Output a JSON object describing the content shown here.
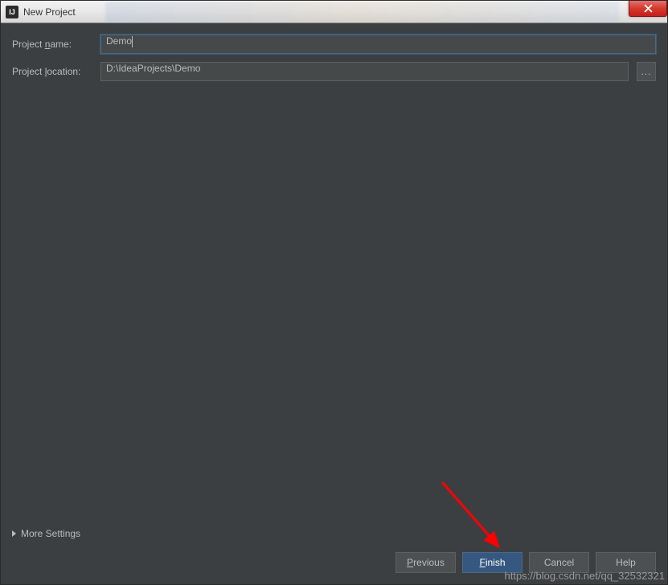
{
  "window": {
    "title": "New Project"
  },
  "form": {
    "project_name_label": "Project name:",
    "project_name_value": "Demo",
    "project_location_label": "Project location:",
    "project_location_value": "D:\\IdeaProjects\\Demo",
    "browse_label": "..."
  },
  "more_settings_label": "More Settings",
  "buttons": {
    "previous": "Previous",
    "finish": "Finish",
    "cancel": "Cancel",
    "help": "Help"
  },
  "watermark": "https://blog.csdn.net/qq_32532321"
}
